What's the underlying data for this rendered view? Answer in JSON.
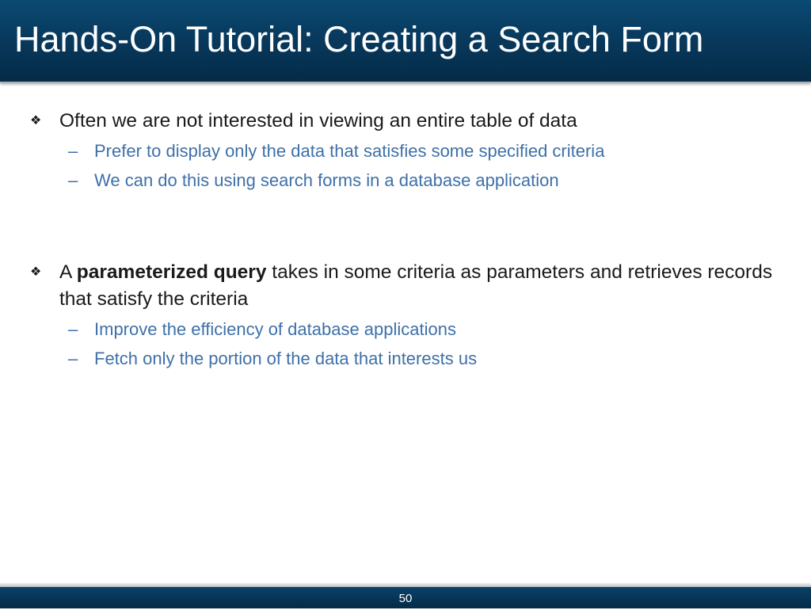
{
  "slide": {
    "title": "Hands-On Tutorial: Creating a Search Form",
    "page_number": "50"
  },
  "bullets": [
    {
      "icon": "diamond-bullet-icon",
      "text": "Often we are not interested in viewing an entire table of data",
      "subitems": [
        "Prefer to display only the data that satisfies some specified criteria",
        "We can do this using search forms in a database application"
      ]
    },
    {
      "icon": "diamond-bullet-icon",
      "text_prefix": "A ",
      "text_bold": "parameterized query",
      "text_suffix": " takes in some criteria as parameters and retrieves records that satisfy the criteria",
      "subitems": [
        "Improve the efficiency of database applications",
        "Fetch only the portion of the data that interests us"
      ]
    }
  ],
  "colors": {
    "title_bar": "#083a5e",
    "sub_text": "#3e70a8",
    "body_text": "#1a1a1a"
  }
}
